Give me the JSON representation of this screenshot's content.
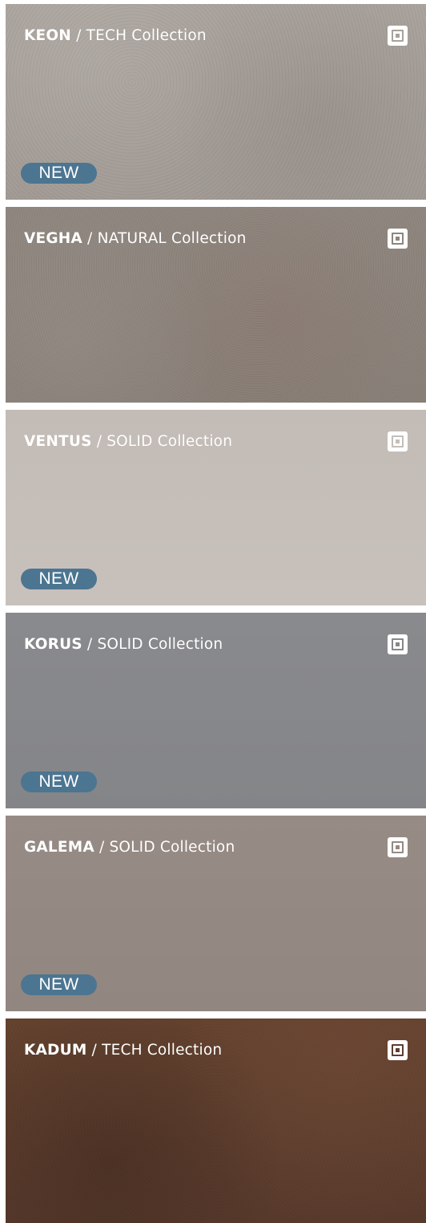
{
  "products": [
    {
      "name": "KEON",
      "separator": " / ",
      "collection": "TECH Collection",
      "is_new": true,
      "badge": "NEW",
      "icon": "sample-square-icon",
      "color": "#a9a29c",
      "badge_color": "#4c7591"
    },
    {
      "name": "VEGHA",
      "separator": " / ",
      "collection": "NATURAL Collection",
      "is_new": false,
      "badge": "",
      "icon": "sample-square-icon",
      "color": "#8d847c",
      "badge_color": "#4c7591"
    },
    {
      "name": "VENTUS",
      "separator": " / ",
      "collection": "SOLID Collection",
      "is_new": true,
      "badge": "NEW",
      "icon": "sample-square-icon",
      "color": "#c5beb8",
      "badge_color": "#4c7591"
    },
    {
      "name": "KORUS",
      "separator": " / ",
      "collection": "SOLID Collection",
      "is_new": true,
      "badge": "NEW",
      "icon": "sample-square-icon",
      "color": "#87888b",
      "badge_color": "#4c7591"
    },
    {
      "name": "GALEMA",
      "separator": " / ",
      "collection": "SOLID Collection",
      "is_new": true,
      "badge": "NEW",
      "icon": "sample-square-icon",
      "color": "#958983",
      "badge_color": "#4c7591"
    },
    {
      "name": "KADUM",
      "separator": " / ",
      "collection": "TECH Collection",
      "is_new": false,
      "badge": "",
      "icon": "sample-square-icon",
      "color": "#5e3d2e",
      "badge_color": "#4c7591"
    }
  ]
}
